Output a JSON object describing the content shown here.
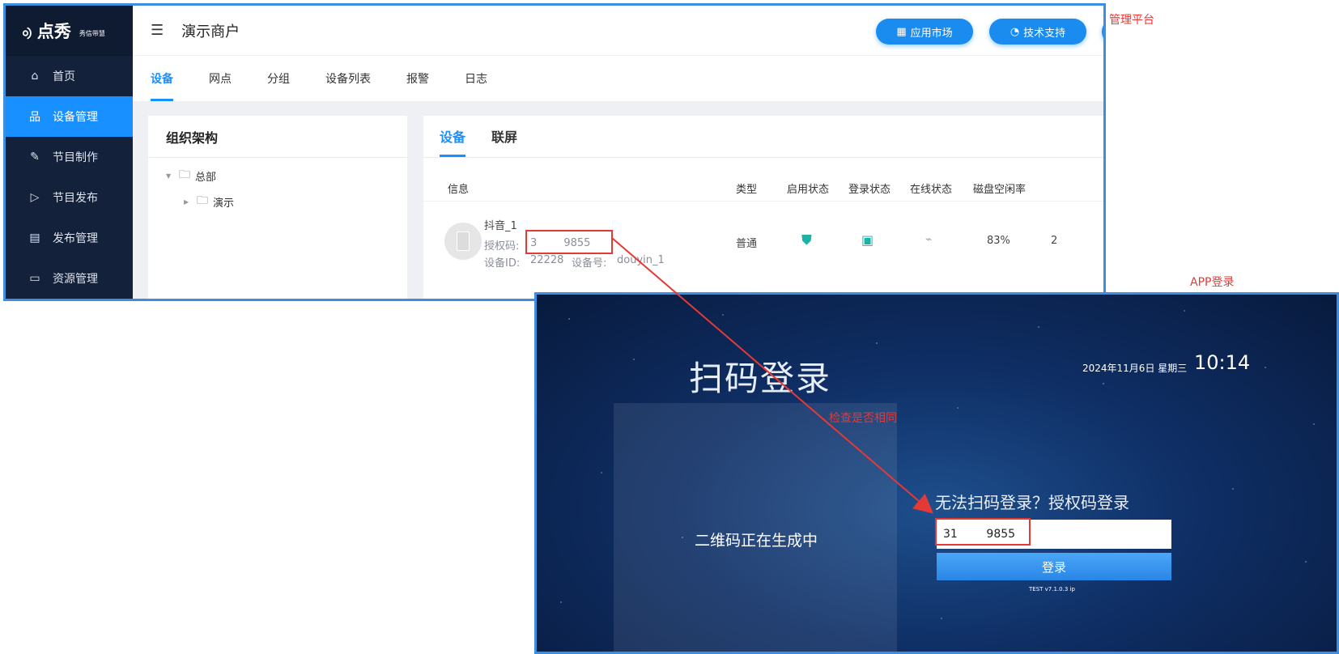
{
  "admin": {
    "logo": {
      "name": "点秀",
      "sub": "秀信带慧"
    },
    "sidebar": {
      "items": [
        {
          "label": "首页",
          "icon": "home-icon"
        },
        {
          "label": "设备管理",
          "icon": "sitemap-icon",
          "active": true
        },
        {
          "label": "节目制作",
          "icon": "edit-icon"
        },
        {
          "label": "节目发布",
          "icon": "send-icon"
        },
        {
          "label": "发布管理",
          "icon": "list-icon"
        },
        {
          "label": "资源管理",
          "icon": "folder-icon"
        }
      ]
    },
    "topbar": {
      "merchant": "演示商户",
      "market_button": "应用市场",
      "support_button": "技术支持"
    },
    "tabs": [
      "设备",
      "网点",
      "分组",
      "设备列表",
      "报警",
      "日志"
    ],
    "org": {
      "title": "组织架构",
      "tree": [
        {
          "label": "总部",
          "level": 0
        },
        {
          "label": "演示",
          "level": 1
        }
      ]
    },
    "device_panel": {
      "tabs": [
        "设备",
        "联屏"
      ],
      "headers": [
        "信息",
        "类型",
        "启用状态",
        "登录状态",
        "在线状态",
        "磁盘空闲率"
      ],
      "row": {
        "name": "抖音_1",
        "auth_label": "授权码:",
        "auth_code": "3        9855",
        "device_id_label": "设备ID:",
        "device_id": "22228",
        "device_no_label": "设备号:",
        "device_no": "douyin_1",
        "type": "普通",
        "disk_free": "83%",
        "trailing": "2"
      }
    }
  },
  "annotations": {
    "admin_label": "管理平台",
    "app_label": "APP登录",
    "check_label": "检查是否相同"
  },
  "app": {
    "title": "扫码登录",
    "date": "2024年11月6日  星期三",
    "time": "10:14",
    "qr_status": "二维码正在生成中",
    "auth_title": "无法扫码登录？授权码登录",
    "auth_value": "31        9855",
    "login_button": "登录",
    "version": "TEST v7.1.0.3     ip"
  },
  "colors": {
    "accent": "#1890ff",
    "sidebar": "#13213a",
    "highlight": "#e53935"
  }
}
